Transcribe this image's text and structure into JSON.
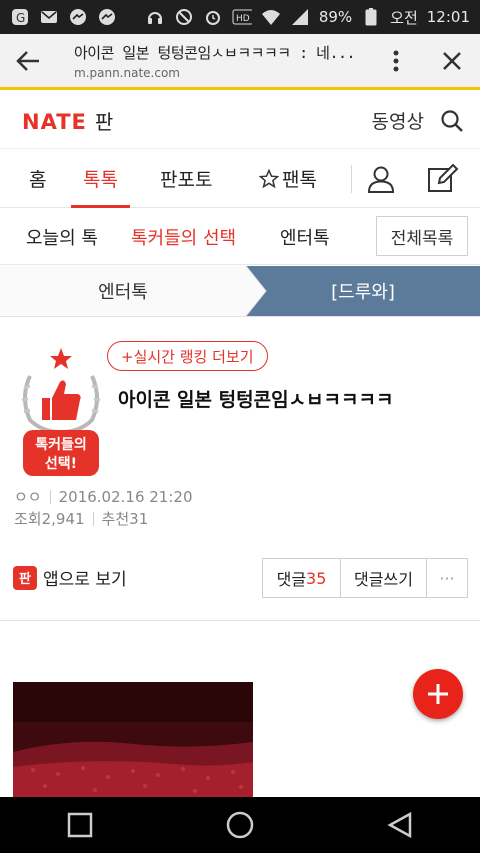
{
  "status_bar": {
    "battery": "89%",
    "ampm": "오전",
    "time": "12:01"
  },
  "url_bar": {
    "title": "아이콘 일본 텅텅콘임ㅅㅂㅋㅋㅋㅋ : 네...",
    "host": "m.pann.nate.com"
  },
  "app_bar": {
    "logo": "NATE",
    "logo_suffix": "판",
    "video_label": "동영상"
  },
  "main_nav": {
    "items": [
      {
        "label": "홈"
      },
      {
        "label": "톡톡",
        "active": true
      },
      {
        "label": "판포토"
      },
      {
        "label": "팬톡"
      }
    ]
  },
  "sub_nav": {
    "items": [
      {
        "label": "오늘의 톡"
      },
      {
        "label": "톡커들의 선택",
        "active": true
      },
      {
        "label": "엔터톡"
      }
    ],
    "all_label": "전체목록"
  },
  "crumb": {
    "left": "엔터톡",
    "right": "[드루와]"
  },
  "post": {
    "rank_link": "+실시간 랭킹 더보기",
    "badge_text_1": "톡커들의",
    "badge_text_2": "선택!",
    "title": "아이콘 일본 텅텅콘임ㅅㅂㅋㅋㅋㅋ",
    "author": "ㅇㅇ",
    "date": "2016.02.16 21:20",
    "views": "조회2,941",
    "recommends": "추천31",
    "app_view": "앱으로 보기",
    "app_icon_text": "판",
    "comments_label": "댓글",
    "comments_count": "35",
    "write_comment": "댓글쓰기",
    "more": "···"
  },
  "colors": {
    "accent": "#e63329",
    "crumb_blue": "#5c7a99",
    "url_underline": "#f5c400"
  }
}
